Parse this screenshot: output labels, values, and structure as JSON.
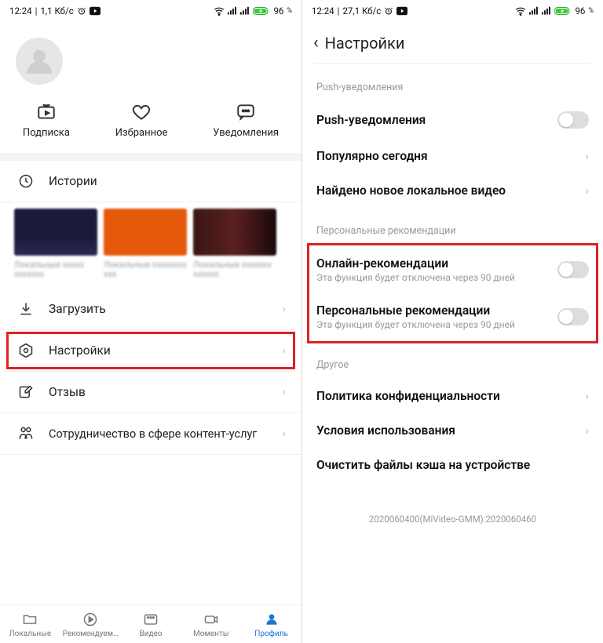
{
  "left": {
    "status": {
      "time": "12:24",
      "net": "1,1 Кб/с",
      "batt": "96"
    },
    "actions": {
      "sub": "Подписка",
      "fav": "Избранное",
      "notif": "Уведомления"
    },
    "rows": {
      "history": "Истории",
      "download": "Загрузить",
      "settings": "Настройки",
      "feedback": "Отзыв",
      "partner": "Сотрудничество в сфере контент-услуг"
    },
    "tabs": {
      "local": "Локальные",
      "recom": "Рекомендуем…",
      "video": "Видео",
      "moments": "Моменты",
      "profile": "Профиль"
    }
  },
  "right": {
    "status": {
      "time": "12:24",
      "net": "27,1 Кб/с",
      "batt": "96"
    },
    "title": "Настройки",
    "sect_push": "Push-уведомления",
    "push": {
      "push": "Push-уведомления",
      "popular": "Популярно сегодня",
      "localvid": "Найдено новое локальное видео"
    },
    "sect_pers": "Персональные рекомендации",
    "online": {
      "t": "Онлайн-рекомендации",
      "s": "Эта функция будет отключена через 90 дней"
    },
    "personal": {
      "t": "Персональные рекомендации",
      "s": "Эта функция будет отключена через 90 дней"
    },
    "sect_other": "Другое",
    "other": {
      "privacy": "Политика конфиденциальности",
      "terms": "Условия использования",
      "cache": "Очистить файлы кэша на устройстве"
    },
    "ver": "2020060400(MiVideo-GMM):2020060460"
  }
}
